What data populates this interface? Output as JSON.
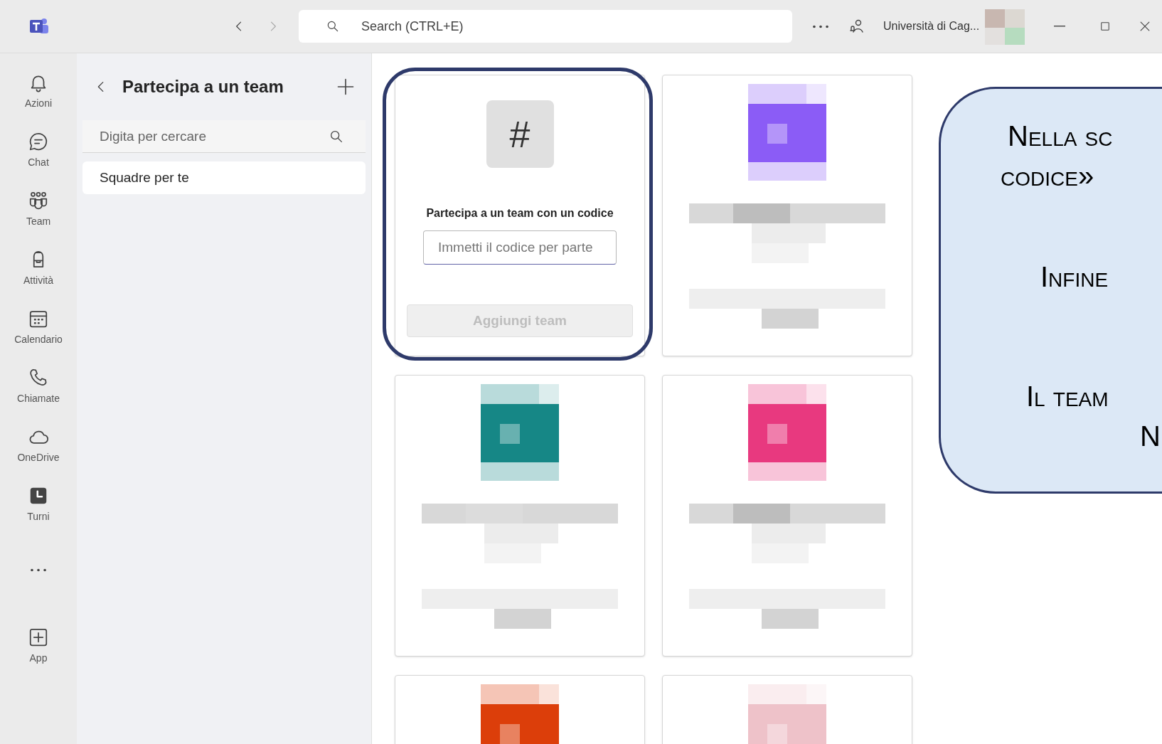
{
  "title_bar": {
    "search": {
      "placeholder": "Search (CTRL+E)"
    },
    "account": "Università di Cag..."
  },
  "rail": [
    {
      "kind": "item",
      "label": "Azioni"
    },
    {
      "kind": "item",
      "label": "Chat"
    },
    {
      "kind": "item",
      "label": "Team"
    },
    {
      "kind": "item",
      "label": "Attività"
    },
    {
      "kind": "item",
      "label": "Calendario"
    },
    {
      "kind": "item",
      "label": "Chiamate"
    },
    {
      "kind": "item",
      "label": "OneDrive"
    },
    {
      "kind": "item",
      "label": "Turni"
    },
    {
      "kind": "more"
    },
    {
      "kind": "item",
      "label": "App"
    }
  ],
  "panel": {
    "title": "Partecipa a un team",
    "search": {
      "placeholder": "Digita per cercare"
    },
    "items": [
      {
        "label": "Squadre per te",
        "selected": true
      }
    ]
  },
  "cards": [
    {
      "kind": "join",
      "icon": "#",
      "heading": "Partecipa a un team con un codice",
      "placeholder": "Immetti il codice per parte",
      "button": "Aggiungi team",
      "highlighted": true
    },
    {
      "kind": "picture",
      "color": "#8b5cf6"
    },
    {
      "kind": "picture",
      "color": "#168786"
    },
    {
      "kind": "picture",
      "color": "#e8397f"
    },
    {
      "kind": "picture",
      "color": "#dc3e0a"
    },
    {
      "kind": "picture",
      "color": "#eec2c9"
    }
  ],
  "callout": {
    "lines": [
      "Nella sc",
      "codice»",
      "Infine",
      "Il team",
      "N"
    ]
  }
}
